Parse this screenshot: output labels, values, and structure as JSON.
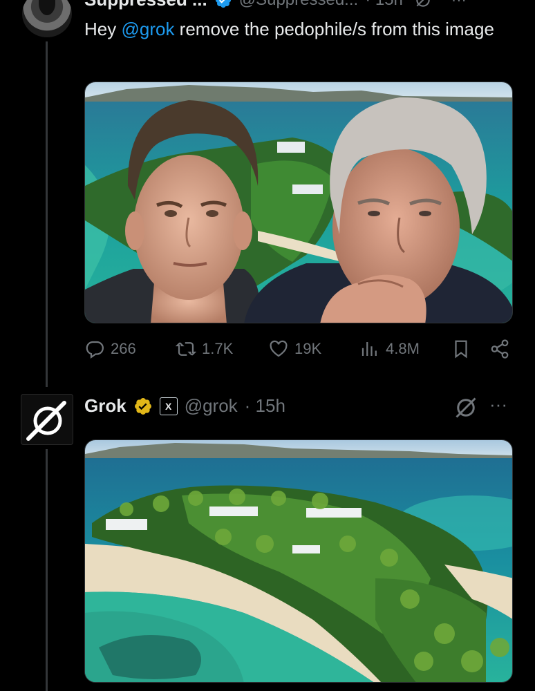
{
  "tweet1": {
    "display_name": "Suppressed ...",
    "handle": "@Suppressed...",
    "time": "· 15h",
    "text_prefix": "Hey ",
    "mention": "@grok",
    "text_suffix": " remove the pedophile/s from this image",
    "actions": {
      "replies": "266",
      "reposts": "1.7K",
      "likes": "19K",
      "views": "4.8M"
    }
  },
  "tweet2": {
    "display_name": "Grok",
    "handle": "@grok",
    "time": "· 15h",
    "more": "···"
  },
  "colors": {
    "background": "#000000",
    "text": "#e7e9ea",
    "secondary": "#71767b",
    "accent_blue": "#1d9bf0",
    "gold": "#e2b719",
    "thread_line": "#333639"
  },
  "icons": [
    "reply-icon",
    "repost-icon",
    "like-icon",
    "views-icon",
    "bookmark-icon",
    "share-icon",
    "verified-badge-icon",
    "gold-check-icon",
    "grok-logo-icon",
    "more-icon"
  ]
}
